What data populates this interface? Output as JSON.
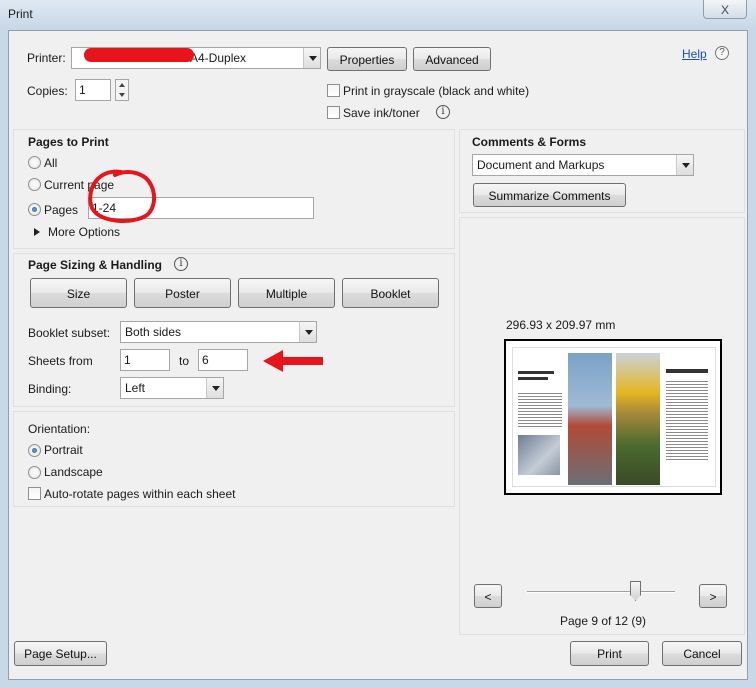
{
  "window": {
    "title": "Print",
    "close_label": "X"
  },
  "printer": {
    "label": "Printer:",
    "name": "A4-Duplex",
    "properties_label": "Properties",
    "advanced_label": "Advanced",
    "help_label": "Help"
  },
  "copies": {
    "label": "Copies:",
    "value": "1"
  },
  "options": {
    "grayscale_label": "Print in grayscale (black and white)",
    "save_ink_label": "Save ink/toner"
  },
  "pages_to_print": {
    "heading": "Pages to Print",
    "all_label": "All",
    "current_label": "Current page",
    "pages_label": "Pages",
    "pages_value": "1-24",
    "more_options_label": "More Options",
    "selected": "Pages"
  },
  "sizing": {
    "heading": "Page Sizing & Handling",
    "tabs": [
      "Size",
      "Poster",
      "Multiple",
      "Booklet"
    ],
    "booklet_subset_label": "Booklet subset:",
    "booklet_subset_value": "Both sides",
    "sheets_from_label": "Sheets from",
    "sheets_from_value": "1",
    "sheets_to_label": "to",
    "sheets_to_value": "6",
    "binding_label": "Binding:",
    "binding_value": "Left"
  },
  "orientation": {
    "heading": "Orientation:",
    "portrait_label": "Portrait",
    "landscape_label": "Landscape",
    "autorotate_label": "Auto-rotate pages within each sheet",
    "selected": "Portrait"
  },
  "comments": {
    "heading": "Comments & Forms",
    "value": "Document and Markups",
    "summarize_label": "Summarize Comments"
  },
  "preview": {
    "size_label": "296.93 x 209.97 mm",
    "prev_label": "<",
    "next_label": ">",
    "page_status": "Page 9 of 12 (9)",
    "page_fraction": 0.73
  },
  "footer": {
    "page_setup_label": "Page Setup...",
    "print_label": "Print",
    "cancel_label": "Cancel"
  },
  "colors": {
    "annotation_red": "#e8141b",
    "link_blue": "#1c4fbd"
  }
}
